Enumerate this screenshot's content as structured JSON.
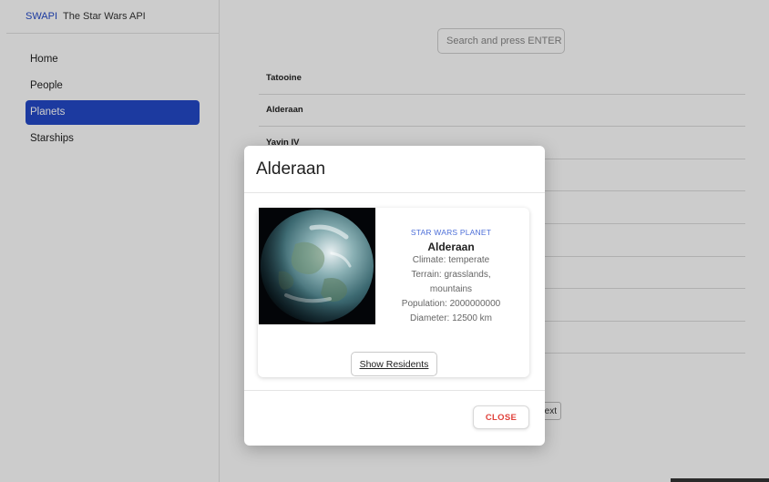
{
  "brand": {
    "short": "SWAPI",
    "full": "The Star Wars API"
  },
  "nav": {
    "items": [
      {
        "label": "Home",
        "active": false
      },
      {
        "label": "People",
        "active": false
      },
      {
        "label": "Planets",
        "active": true
      },
      {
        "label": "Starships",
        "active": false
      }
    ]
  },
  "search": {
    "placeholder": "Search and press ENTER",
    "value": ""
  },
  "planets": {
    "visible_rows": [
      "Tatooine",
      "Alderaan",
      "Yavin IV"
    ],
    "next_label": "Next"
  },
  "modal": {
    "title": "Alderaan",
    "card": {
      "kicker": "STAR WARS PLANET",
      "name": "Alderaan",
      "climate": "Climate: temperate",
      "terrain": "Terrain: grasslands, mountains",
      "population": "Population: 2000000000",
      "diameter": "Diameter: 12500 km",
      "image_icon": "planet-image"
    },
    "residents_label": "Show Residents",
    "close_label": "CLOSE"
  },
  "colors": {
    "accent": "#2349c8",
    "kicker": "#4d6fd8",
    "close": "#e0413b",
    "overlay": "rgba(0,0,0,0.2)"
  }
}
